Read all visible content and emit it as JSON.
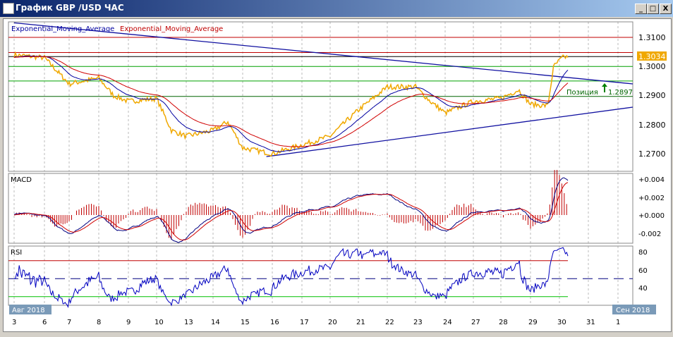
{
  "window": {
    "title": "График GBP /USD  ЧАС",
    "buttons": [
      "_",
      "□",
      "X"
    ]
  },
  "legend": {
    "ema1": "Exponential_Moving_Average",
    "ema2": "Exponential_Moving_Average"
  },
  "price_axis": [
    "1.3100",
    "1.3000",
    "1.2900",
    "1.2800",
    "1.2700"
  ],
  "current_price": "1.3034",
  "position": {
    "label": "Позиция",
    "price": "1.2897"
  },
  "macd": {
    "label": "MACD",
    "axis": [
      "+0.004",
      "+0.002",
      "+0.000",
      "-0.002"
    ]
  },
  "rsi": {
    "label": "RSI",
    "axis": [
      "80",
      "60",
      "40"
    ]
  },
  "x_axis": {
    "labels": [
      "3",
      "6",
      "7",
      "8",
      "9",
      "10",
      "13",
      "14",
      "15",
      "16",
      "17",
      "20",
      "21",
      "22",
      "23",
      "24",
      "27",
      "28",
      "29",
      "30",
      "31",
      "1"
    ],
    "month_start": "Авг 2018",
    "month_end": "Сен 2018"
  },
  "colors": {
    "price": "#f0a800",
    "ema_fast": "#0000a0",
    "ema_slow": "#d00000",
    "rsi_over": "#c000c0"
  },
  "chart_data": {
    "type": "line",
    "price_keypoints": [
      [
        0,
        1.304
      ],
      [
        1,
        1.303
      ],
      [
        2,
        1.294
      ],
      [
        3,
        1.296
      ],
      [
        3.5,
        1.29
      ],
      [
        4,
        1.288
      ],
      [
        5,
        1.289
      ],
      [
        5.5,
        1.278
      ],
      [
        6,
        1.276
      ],
      [
        7,
        1.278
      ],
      [
        7.5,
        1.281
      ],
      [
        8,
        1.272
      ],
      [
        9,
        1.27
      ],
      [
        10,
        1.273
      ],
      [
        11,
        1.276
      ],
      [
        12,
        1.285
      ],
      [
        13,
        1.293
      ],
      [
        14,
        1.293
      ],
      [
        14.5,
        1.288
      ],
      [
        15,
        1.284
      ],
      [
        16,
        1.288
      ],
      [
        17,
        1.289
      ],
      [
        17.6,
        1.292
      ],
      [
        18,
        1.287
      ],
      [
        18.6,
        1.2865
      ],
      [
        18.8,
        1.3
      ],
      [
        19.1,
        1.303
      ],
      [
        19.3,
        1.3034
      ]
    ],
    "hlines": [
      1.31,
      1.3048,
      1.3034,
      1.3,
      1.295,
      1.2897
    ],
    "trendlines": [
      [
        [
          0,
          1.315
        ],
        [
          21.5,
          1.294
        ]
      ],
      [
        [
          8.8,
          1.269
        ],
        [
          21.5,
          1.286
        ]
      ]
    ],
    "rsi_levels": [
      70,
      50,
      30
    ],
    "price_range": [
      1.266,
      1.316
    ],
    "macd_range": [
      -0.0028,
      0.0048
    ],
    "rsi_range": [
      15,
      90
    ]
  }
}
